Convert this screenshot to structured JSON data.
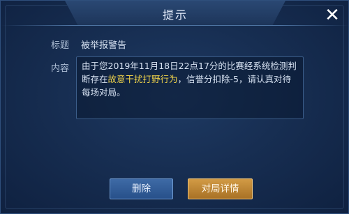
{
  "dialog": {
    "title": "提示",
    "close_glyph": "✕"
  },
  "fields": {
    "title_label": "标题",
    "title_value": "被举报警告",
    "content_label": "内容",
    "content_part1": "由于您2019年11月18日22点17分的比赛经系统检测判断存在",
    "content_highlight": "故意干扰打野行为",
    "content_part2": "，信誉分扣除-5，请认真对待每场对局。"
  },
  "buttons": {
    "delete_label": "删除",
    "details_label": "对局详情"
  },
  "colors": {
    "highlight": "#f1d44a",
    "primary_button": "#27508a",
    "secondary_button": "#a87125"
  },
  "icons": {
    "close": "close-icon"
  }
}
